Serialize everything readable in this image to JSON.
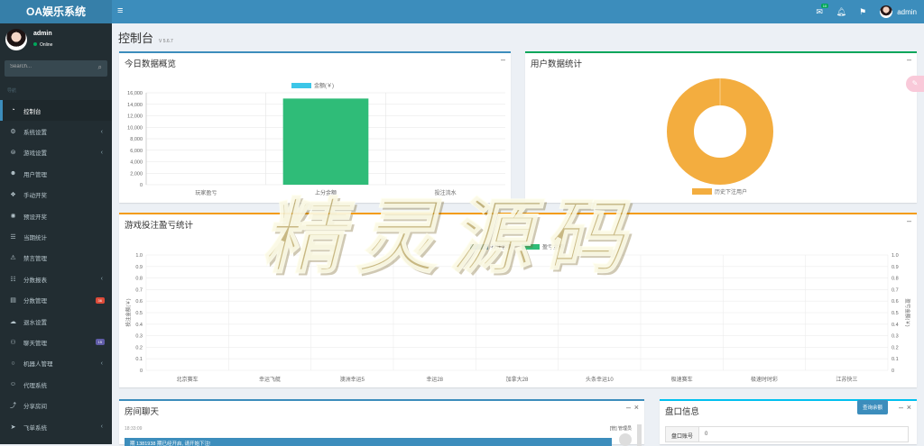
{
  "app": {
    "logo": "OA娱乐系统",
    "menu_icon": "bars-icon"
  },
  "topbar": {
    "mail_badge": "10",
    "admin": "admin"
  },
  "user": {
    "name": "admin",
    "status": "Online"
  },
  "search": {
    "placeholder": "Search..."
  },
  "sidebar": {
    "header": "导航",
    "items": [
      {
        "label": "控制台",
        "icon": "dashboard-icon",
        "active": true
      },
      {
        "label": "系统设置",
        "icon": "cogs-icon",
        "arrow": true
      },
      {
        "label": "游戏设置",
        "icon": "gamepad-icon",
        "arrow": true
      },
      {
        "label": "用户管理",
        "icon": "users-icon"
      },
      {
        "label": "手动开奖",
        "icon": "cubes-icon"
      },
      {
        "label": "预设开奖",
        "icon": "gear-icon"
      },
      {
        "label": "当期统计",
        "icon": "list-icon"
      },
      {
        "label": "禁言管理",
        "icon": "warning-icon"
      },
      {
        "label": "分数报表",
        "icon": "list-ol-icon",
        "arrow": true
      },
      {
        "label": "分数管理",
        "icon": "money-icon",
        "badge": "36",
        "badge_color": "#dd4b39"
      },
      {
        "label": "退水设置",
        "icon": "cloud-icon"
      },
      {
        "label": "聊天管理",
        "icon": "comments-icon",
        "badge": "15",
        "badge_color": "#605ca8"
      },
      {
        "label": "机器人管理",
        "icon": "comment-icon",
        "arrow": true
      },
      {
        "label": "代理系统",
        "icon": "user-plus-icon"
      },
      {
        "label": "分享房间",
        "icon": "share-icon"
      },
      {
        "label": "飞单系统",
        "icon": "send-icon",
        "arrow": true
      }
    ]
  },
  "page": {
    "title": "控制台",
    "version": "V 5.6.7"
  },
  "boxes": {
    "today": {
      "title": "今日数据概览",
      "tool": "–"
    },
    "users": {
      "title": "用户数据统计",
      "tool": "–"
    },
    "game": {
      "title": "游戏投注盈亏统计",
      "tool": "–"
    },
    "chat": {
      "title": "房间聊天",
      "tool": "–",
      "close": "×",
      "time": "18:33:09",
      "sender": "[管] 管理员",
      "message": "期 1381938 期已经开启, 请开始下注!"
    },
    "pan": {
      "title": "盘口信息",
      "tool": "–",
      "close": "×",
      "button": "查询余额",
      "field_label": "盘口账号",
      "field_value": "0"
    }
  },
  "watermark": "精灵源码",
  "fab_icon": "bug-icon",
  "colors": {
    "primary": "#3c8dbc",
    "green": "#2fbc78",
    "orange": "#f3ad3f",
    "cyan": "#3cc6e8",
    "red": "#dd4b39",
    "purple": "#605ca8"
  },
  "chart_data": [
    {
      "type": "bar",
      "legend": "金额(￥)",
      "categories": [
        "玩家盈亏",
        "上分金额",
        "投注流水"
      ],
      "values": [
        0,
        15000,
        0
      ],
      "ylim": [
        0,
        16000
      ],
      "yticks": [
        "0",
        "2,000",
        "4,000",
        "6,000",
        "8,000",
        "10,000",
        "12,000",
        "14,000",
        "16,000"
      ]
    },
    {
      "type": "pie",
      "labels": [
        "历史下注用户"
      ],
      "values": [
        1
      ]
    },
    {
      "type": "bar",
      "series": [
        {
          "name": "投注金额",
          "values": [
            0,
            0,
            0,
            0,
            0,
            0,
            0,
            0,
            0
          ]
        },
        {
          "name": "盈亏金额",
          "values": [
            0,
            0,
            0,
            0,
            0,
            0,
            0,
            0,
            0
          ]
        }
      ],
      "categories": [
        "北京赛车",
        "幸运飞艇",
        "澳洲幸运5",
        "幸运28",
        "加拿大28",
        "头条幸运10",
        "极速赛车",
        "极速时时彩",
        "江苏快三"
      ],
      "ylim": [
        0,
        1
      ],
      "yticks": [
        "0",
        "0.1",
        "0.2",
        "0.3",
        "0.4",
        "0.5",
        "0.6",
        "0.7",
        "0.8",
        "0.9",
        "1.0"
      ],
      "ylabel": "投注金额(￥)",
      "ylabel_right": "盈亏金额(￥)"
    }
  ]
}
